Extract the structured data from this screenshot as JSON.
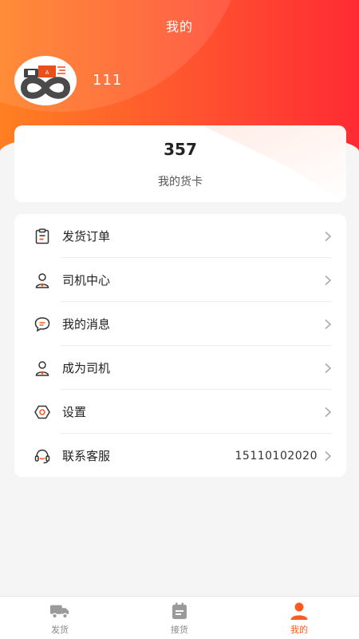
{
  "header": {
    "title": "我的"
  },
  "profile": {
    "username": "111"
  },
  "stat": {
    "value": "357",
    "label": "我的货卡"
  },
  "menu": {
    "items": [
      {
        "label": "发货订单",
        "icon": "clipboard-icon"
      },
      {
        "label": "司机中心",
        "icon": "driver-icon"
      },
      {
        "label": "我的消息",
        "icon": "message-icon"
      },
      {
        "label": "成为司机",
        "icon": "driver-icon"
      },
      {
        "label": "设置",
        "icon": "settings-icon"
      },
      {
        "label": "联系客服",
        "icon": "headset-icon",
        "value": "15110102020"
      }
    ]
  },
  "tabbar": {
    "items": [
      {
        "label": "发货",
        "icon": "truck-icon"
      },
      {
        "label": "接货",
        "icon": "calendar-icon"
      },
      {
        "label": "我的",
        "icon": "person-icon",
        "active": true
      }
    ]
  },
  "colors": {
    "accent": "#ff5a1f",
    "header_start": "#ff7f22",
    "header_end": "#ff2b33"
  }
}
